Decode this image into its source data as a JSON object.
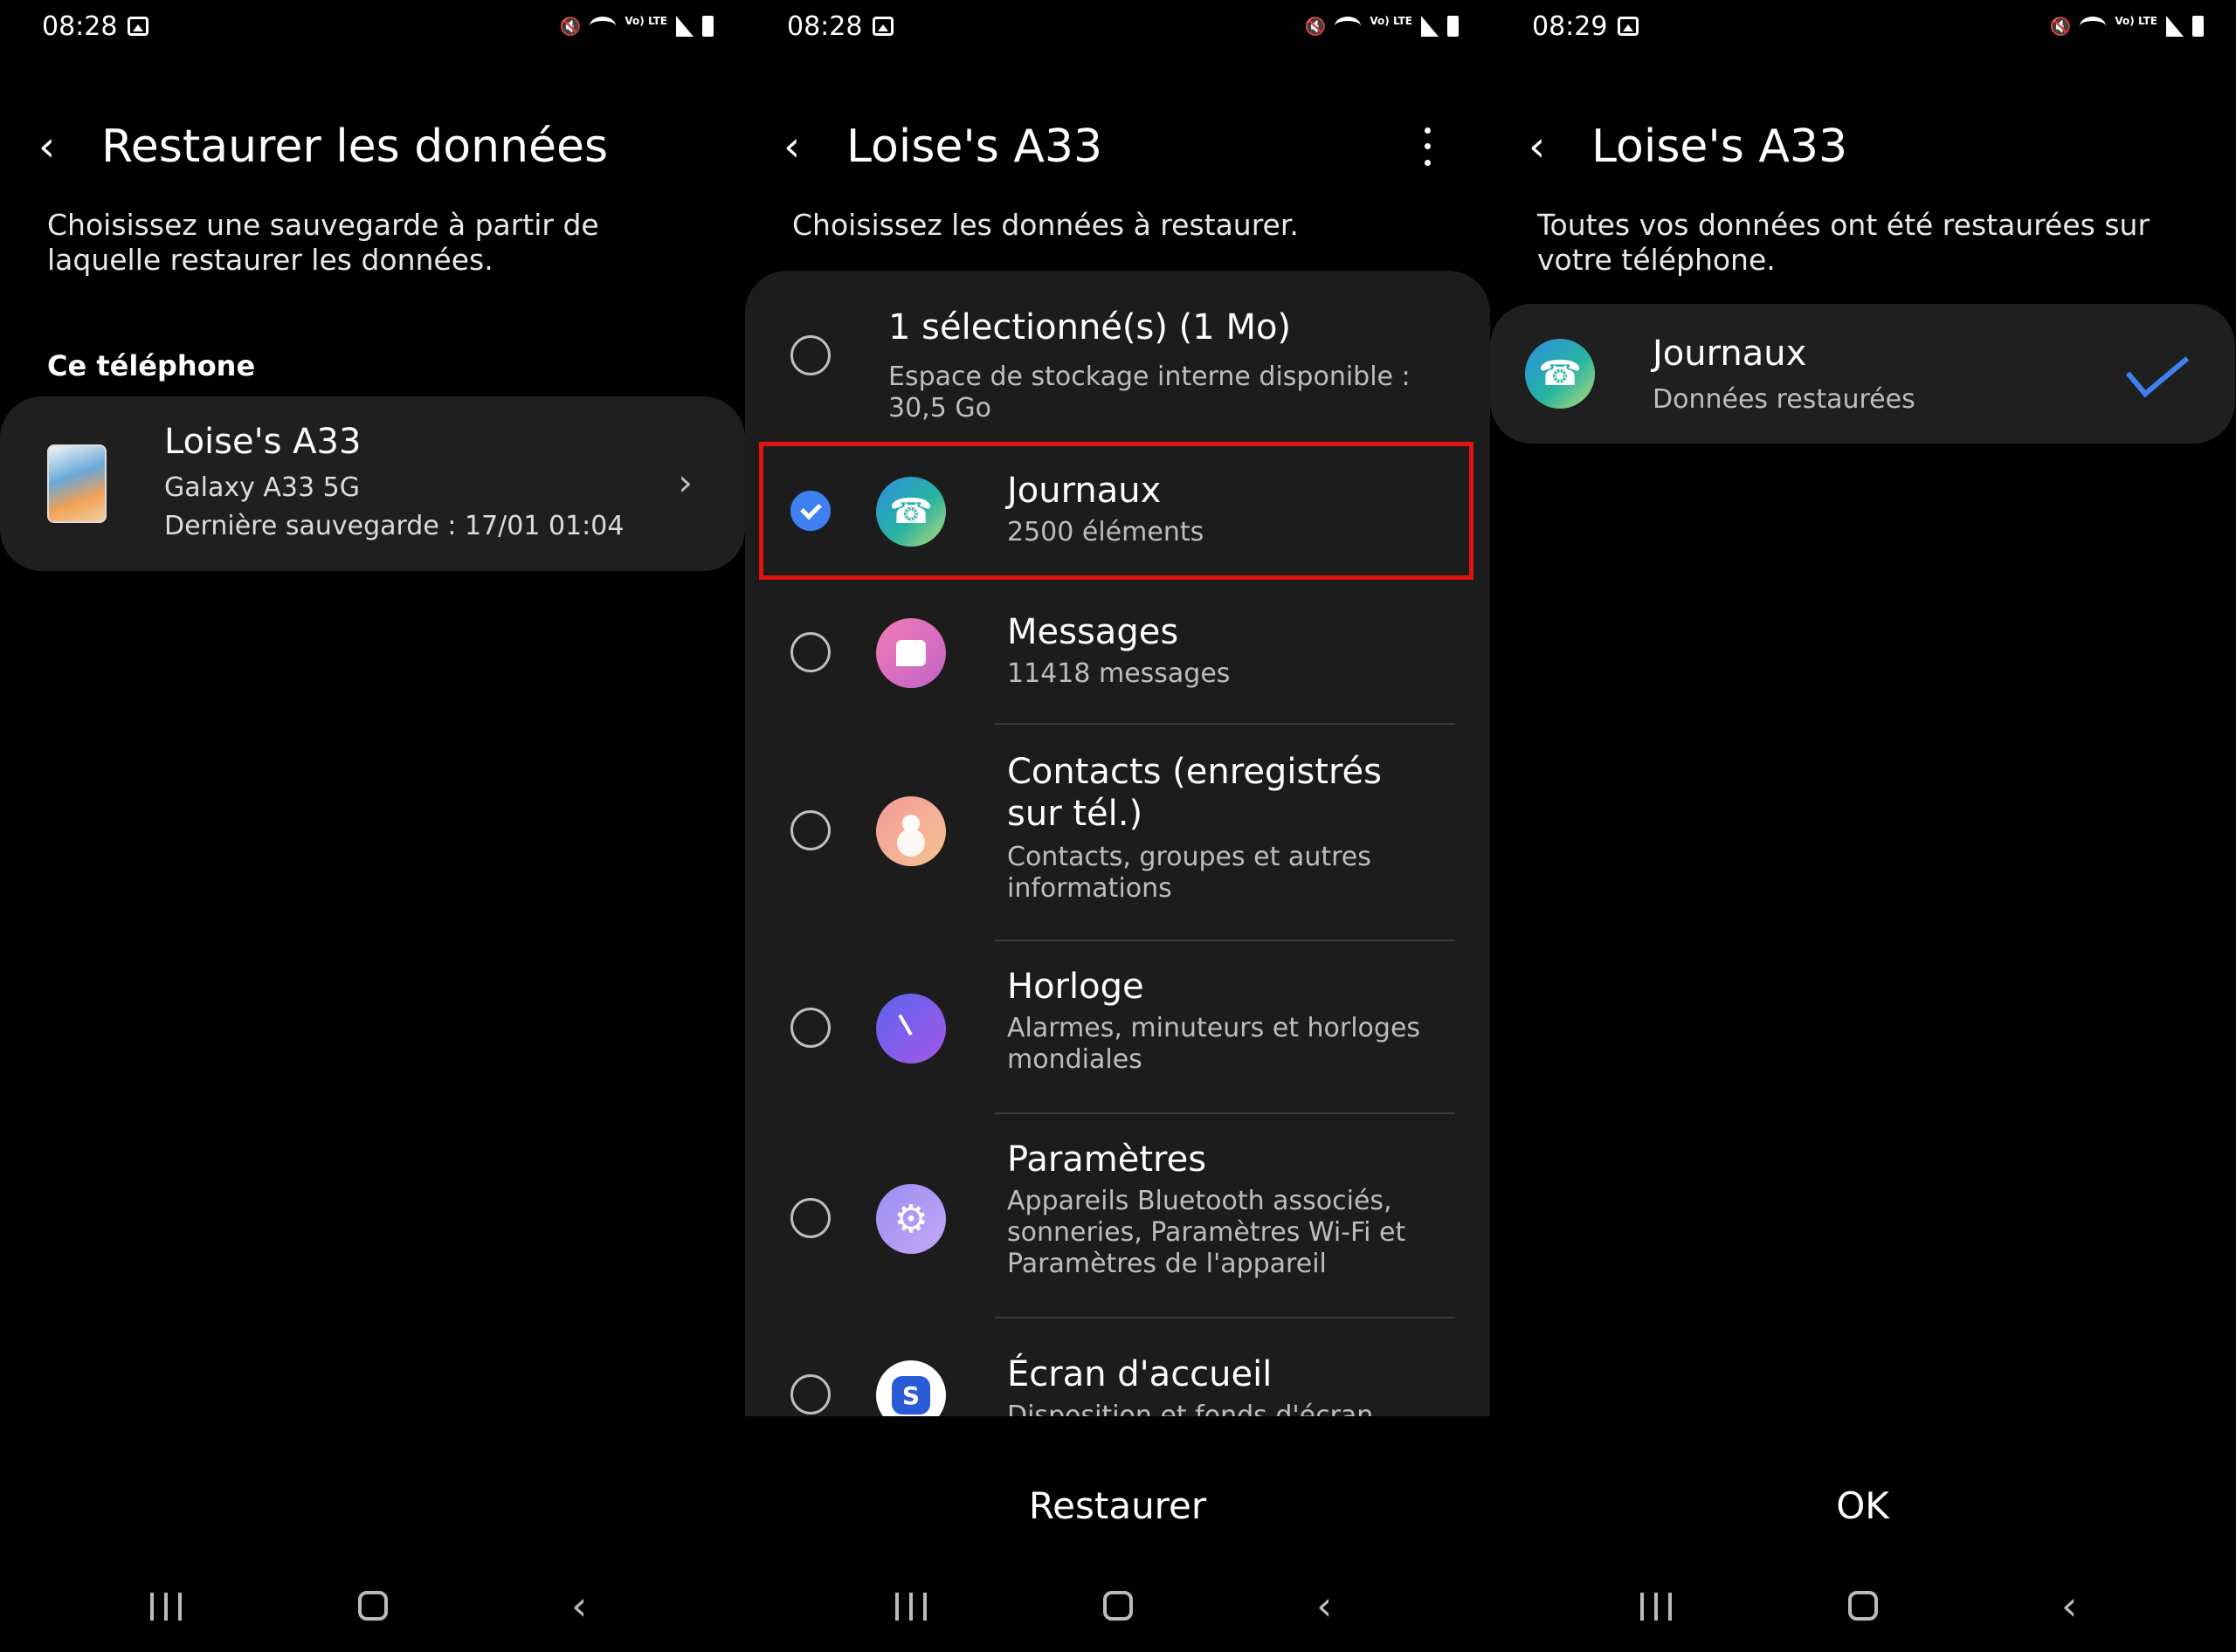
{
  "screen1": {
    "status": {
      "time": "08:28",
      "volte": "Vo) LTE"
    },
    "title": "Restaurer les données",
    "subtitle": "Choisissez une sauvegarde à partir de laquelle restaurer les données.",
    "section": "Ce téléphone",
    "device": {
      "name": "Loise's A33",
      "model": "Galaxy A33 5G",
      "last_backup": "Dernière sauvegarde : 17/01 01:04"
    }
  },
  "screen2": {
    "status": {
      "time": "08:28",
      "volte": "Vo) LTE"
    },
    "title": "Loise's A33",
    "subtitle": "Choisissez les données à restaurer.",
    "summary": {
      "title": "1 sélectionné(s) (1 Mo)",
      "sub": "Espace de stockage interne disponible : 30,5 Go"
    },
    "items": [
      {
        "title": "Journaux",
        "sub": "2500 éléments",
        "checked": true,
        "icon": "phone-icon"
      },
      {
        "title": "Messages",
        "sub": "11418 messages",
        "checked": false,
        "icon": "messages-icon"
      },
      {
        "title": "Contacts (enregistrés sur tél.)",
        "sub": "Contacts, groupes et autres informations",
        "checked": false,
        "icon": "contacts-icon"
      },
      {
        "title": "Horloge",
        "sub": "Alarmes, minuteurs et horloges mondiales",
        "checked": false,
        "icon": "clock-icon"
      },
      {
        "title": "Paramètres",
        "sub": "Appareils Bluetooth associés, sonneries, Paramètres Wi-Fi et Paramètres de l'appareil",
        "checked": false,
        "icon": "settings-icon"
      },
      {
        "title": "Écran d'accueil",
        "sub": "Disposition et fonds d'écran",
        "checked": false,
        "icon": "home-screen-icon"
      }
    ],
    "action": "Restaurer",
    "highlight_color": "#e01313"
  },
  "screen3": {
    "status": {
      "time": "08:29",
      "volte": "Vo) LTE"
    },
    "title": "Loise's A33",
    "subtitle": "Toutes vos données ont été restaurées sur votre téléphone.",
    "result": {
      "title": "Journaux",
      "sub": "Données restaurées"
    },
    "action": "OK"
  },
  "colors": {
    "accent": "#3e7ff2",
    "background": "#000000",
    "card": "#1f1f1f"
  }
}
